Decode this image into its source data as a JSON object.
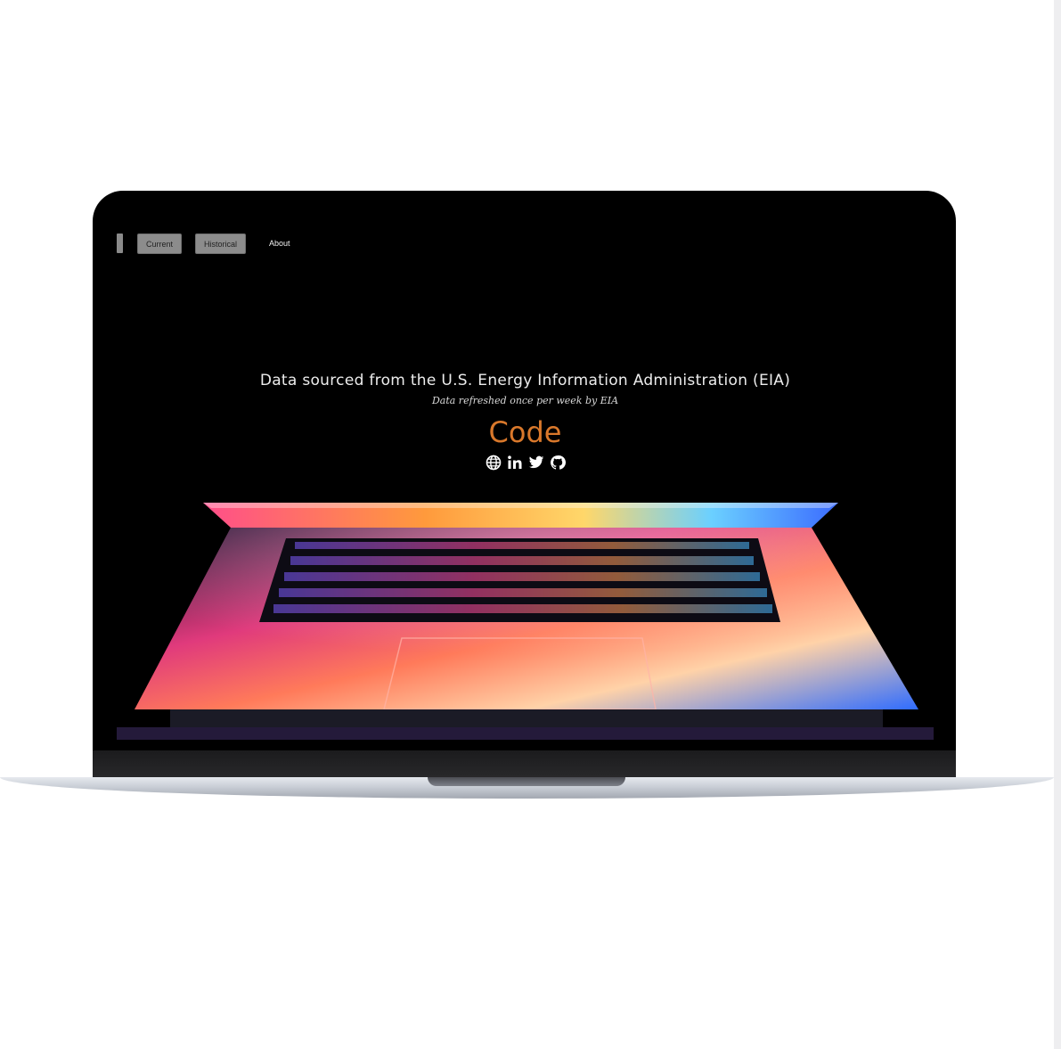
{
  "nav": {
    "buttons": [
      {
        "label": "Current"
      },
      {
        "label": "Historical"
      }
    ],
    "about_label": "About"
  },
  "hero": {
    "title": "Data sourced from the U.S. Energy Information Administration (EIA)",
    "subtitle": "Data refreshed once per week by EIA",
    "code_link": "Code"
  },
  "social_icons": [
    "globe-icon",
    "linkedin-icon",
    "twitter-icon",
    "github-icon"
  ],
  "colors": {
    "code_accent": "#d9782b",
    "screen_bg": "#000000",
    "nav_button": "#8c8c8c"
  }
}
